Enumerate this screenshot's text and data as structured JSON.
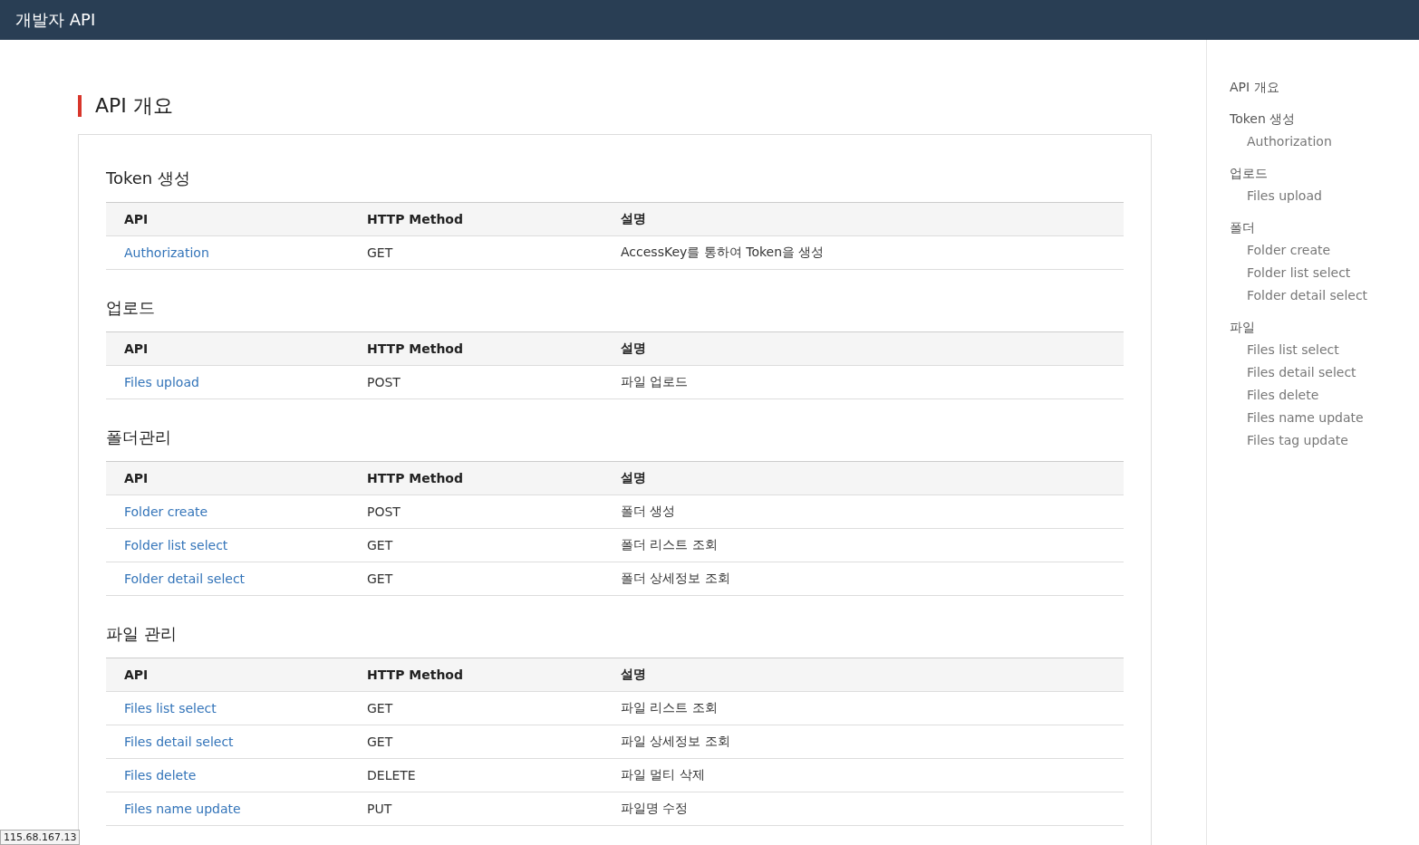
{
  "header": {
    "title": "개발자 API"
  },
  "page_title": "API 개요",
  "sections": [
    {
      "title": "Token 생성",
      "columns": [
        "API",
        "HTTP Method",
        "설명"
      ],
      "rows": [
        {
          "api": "Authorization",
          "method": "GET",
          "description": "AccessKey를 통하여 Token을 생성"
        }
      ]
    },
    {
      "title": "업로드",
      "columns": [
        "API",
        "HTTP Method",
        "설명"
      ],
      "rows": [
        {
          "api": "Files upload",
          "method": "POST",
          "description": "파일 업로드"
        }
      ]
    },
    {
      "title": "폴더관리",
      "columns": [
        "API",
        "HTTP Method",
        "설명"
      ],
      "rows": [
        {
          "api": "Folder create",
          "method": "POST",
          "description": "폴더 생성"
        },
        {
          "api": "Folder list select",
          "method": "GET",
          "description": "폴더 리스트 조회"
        },
        {
          "api": "Folder detail select",
          "method": "GET",
          "description": "폴더 상세정보 조회"
        }
      ]
    },
    {
      "title": "파일 관리",
      "columns": [
        "API",
        "HTTP Method",
        "설명"
      ],
      "rows": [
        {
          "api": "Files list select",
          "method": "GET",
          "description": "파일 리스트 조회"
        },
        {
          "api": "Files detail select",
          "method": "GET",
          "description": "파일 상세정보 조회"
        },
        {
          "api": "Files delete",
          "method": "DELETE",
          "description": "파일 멀티 삭제"
        },
        {
          "api": "Files name update",
          "method": "PUT",
          "description": "파일명 수정"
        }
      ]
    }
  ],
  "toc": [
    {
      "label": "API 개요"
    },
    {
      "label": "Token 생성",
      "children": [
        "Authorization"
      ]
    },
    {
      "label": "업로드",
      "children": [
        "Files upload"
      ]
    },
    {
      "label": "폴더",
      "children": [
        "Folder create",
        "Folder list select",
        "Folder detail select"
      ]
    },
    {
      "label": "파일",
      "children": [
        "Files list select",
        "Files detail select",
        "Files delete",
        "Files name update",
        "Files tag update"
      ]
    }
  ],
  "status_tooltip": "115.68.167.13"
}
